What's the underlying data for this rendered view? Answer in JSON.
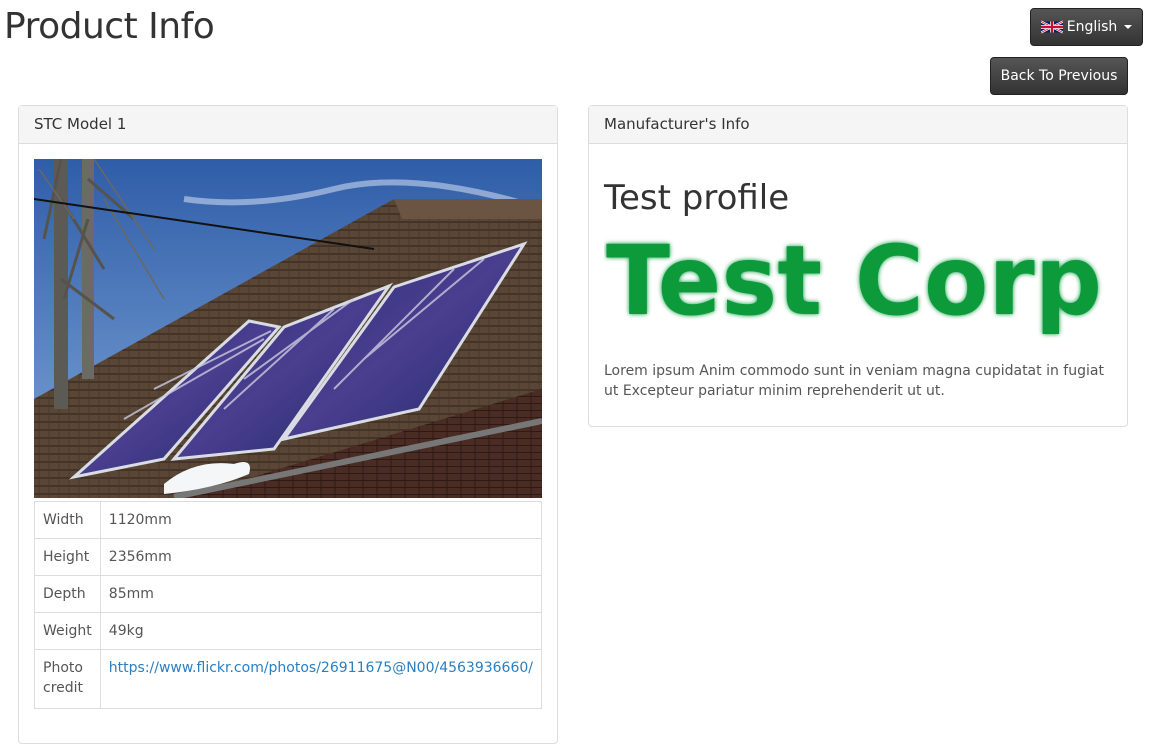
{
  "page": {
    "title": "Product Info"
  },
  "language": {
    "selected": "English",
    "flag_icon": "uk-flag-icon"
  },
  "actions": {
    "back_label": "Back To Previous"
  },
  "product": {
    "heading": "STC Model 1",
    "photo_alt": "Solar thermal collectors on a tiled roof",
    "specs": [
      {
        "label": "Width",
        "value": "1120mm"
      },
      {
        "label": "Height",
        "value": "2356mm"
      },
      {
        "label": "Depth",
        "value": "85mm"
      },
      {
        "label": "Weight",
        "value": "49kg"
      },
      {
        "label": "Photo credit",
        "value": "https://www.flickr.com/photos/26911675@N00/4563936660/"
      }
    ]
  },
  "manufacturer": {
    "heading": "Manufacturer's Info",
    "profile_title": "Test profile",
    "logo_text": "Test Corp",
    "logo_color": "#0a9a3a",
    "description": "Lorem ipsum Anim commodo sunt in veniam magna cupidatat in fugiat ut Excepteur pariatur minim reprehenderit ut ut."
  }
}
